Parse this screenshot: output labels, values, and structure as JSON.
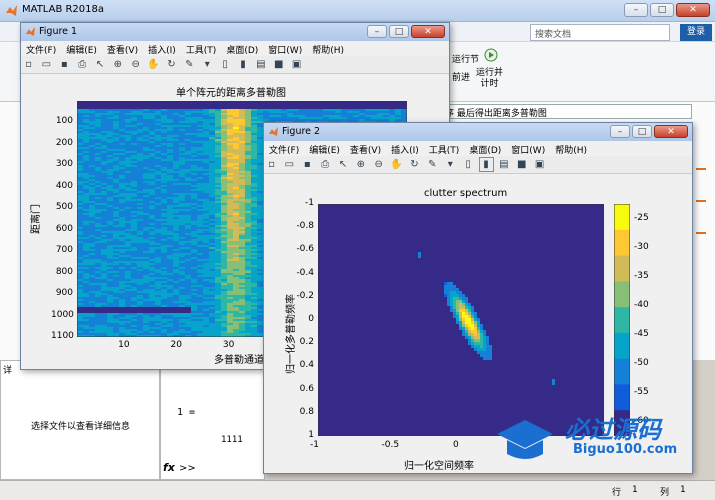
{
  "main": {
    "title": "MATLAB R2018a",
    "search_placeholder": "搜索文档",
    "login": "登录",
    "ribbon_run_section": "运行节",
    "ribbon_advance": "前进",
    "ribbon_run_time": "运行并\n计时",
    "address_text": "序  最后得出距离多普勒图",
    "left_pane_text": "选择文件以查看详细信息",
    "cmd_output_1": "1 =",
    "cmd_output_2": "1111",
    "prompt": ">>",
    "status_row_label": "行",
    "status_row": "1",
    "status_col_label": "列",
    "status_col": "1",
    "left_panel_label": "详"
  },
  "figure1": {
    "title": "Figure 1",
    "menu": [
      "文件(F)",
      "编辑(E)",
      "查看(V)",
      "插入(I)",
      "工具(T)",
      "桌面(D)",
      "窗口(W)",
      "帮助(H)"
    ],
    "chart_data": {
      "type": "heatmap",
      "title": "单个阵元的距离多普勒图",
      "xlabel": "多普勒通道",
      "ylabel": "距离门",
      "x_ticks": [
        10,
        20,
        30
      ],
      "y_ticks": [
        100,
        200,
        300,
        400,
        500,
        600,
        700,
        800,
        900,
        1000,
        1100
      ],
      "xlim": [
        1,
        64
      ],
      "ylim": [
        1,
        1100
      ]
    }
  },
  "figure2": {
    "title": "Figure 2",
    "menu": [
      "文件(F)",
      "编辑(E)",
      "查看(V)",
      "插入(I)",
      "工具(T)",
      "桌面(D)",
      "窗口(W)",
      "帮助(H)"
    ],
    "chart_data": {
      "type": "heatmap",
      "title": "clutter spectrum",
      "xlabel": "归一化空间频率",
      "ylabel": "归一化多普勒频率",
      "x_ticks": [
        -1,
        -0.5,
        0
      ],
      "y_ticks": [
        -1,
        -0.8,
        -0.6,
        -0.4,
        -0.2,
        0,
        0.2,
        0.4,
        0.6,
        0.8,
        1
      ],
      "colorbar_ticks": [
        -25,
        -30,
        -35,
        -40,
        -45,
        -50,
        -55,
        -60
      ],
      "xlim": [
        -1,
        1
      ],
      "ylim": [
        -1,
        1
      ]
    }
  },
  "watermark": {
    "brand": "必过源码",
    "site": "Biguo100.com"
  },
  "colors": {
    "parula_low": "#352a87",
    "parula_high": "#f9fb0e",
    "titlebar": "#bcd1ee"
  }
}
